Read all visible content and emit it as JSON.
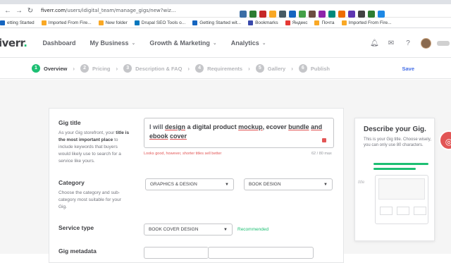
{
  "browser": {
    "url_host": "fiverr.com",
    "url_path": "/users/idigital_team/manage_gigs/new?wiz...",
    "bookmarks": [
      "etting Started",
      "Imported From Fire...",
      "New folder",
      "Drupal SEO Tools o...",
      "Getting Started wit...",
      "Bookmarks",
      "Яндекс",
      "Почта",
      "Imported From Fire..."
    ]
  },
  "header": {
    "logo": "iverr",
    "logo_dot": ".",
    "menu": [
      {
        "label": "Dashboard",
        "has_chevron": false
      },
      {
        "label": "My Business",
        "has_chevron": true
      },
      {
        "label": "Growth & Marketing",
        "has_chevron": true
      },
      {
        "label": "Analytics",
        "has_chevron": true
      }
    ]
  },
  "steps": {
    "items": [
      {
        "num": "1",
        "label": "Overview"
      },
      {
        "num": "2",
        "label": "Pricing"
      },
      {
        "num": "3",
        "label": "Description & FAQ"
      },
      {
        "num": "4",
        "label": "Requirements"
      },
      {
        "num": "5",
        "label": "Gallery"
      },
      {
        "num": "6",
        "label": "Publish"
      }
    ],
    "save_label": "Save"
  },
  "form": {
    "gig_title": {
      "label": "Gig title",
      "help_pre": "As your Gig storefront, your ",
      "help_bold": "title is the most important place",
      "help_post": " to include keywords that buyers would likely use to search for a service like yours.",
      "value_prefix": "I will",
      "value_part1": "design",
      "value_part2": "a digital product",
      "value_part3": "mockup",
      "value_part4": ", ecover",
      "value_part5": "bundle",
      "value_part6": "and",
      "value_part7": "ebook",
      "value_part8": "cover",
      "hint": "Looks good, however, shorter titles sell better",
      "counter": "62 / 80 max"
    },
    "category": {
      "label": "Category",
      "help": "Choose the category and sub-category most suitable for your Gig.",
      "primary": "GRAPHICS & DESIGN",
      "secondary": "BOOK DESIGN"
    },
    "service_type": {
      "label": "Service type",
      "value": "BOOK COVER DESIGN",
      "badge": "Recommended"
    },
    "gig_metadata": {
      "label": "Gig metadata"
    }
  },
  "side_panel": {
    "title": "Describe your Gig.",
    "text": "This is your Gig title. Choose wisely, you can only use 80 characters.",
    "sketch_label": "title"
  },
  "colors": {
    "brand_green": "#1dbf73",
    "error_red": "#e25555",
    "link_blue": "#446ee7"
  }
}
